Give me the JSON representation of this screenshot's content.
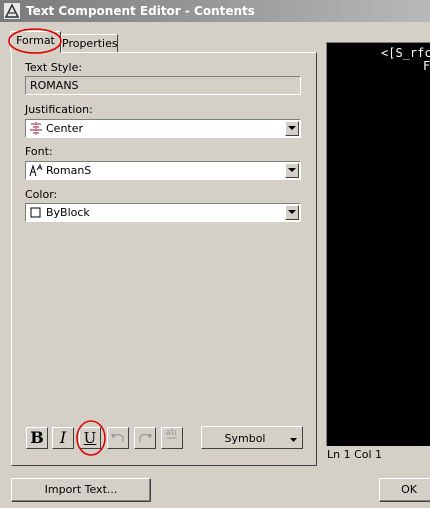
{
  "window": {
    "title": "Text Component Editor - Contents"
  },
  "tabs": [
    {
      "label": "Format",
      "active": true
    },
    {
      "label": "Properties",
      "active": false
    }
  ],
  "format": {
    "text_style": {
      "label": "Text Style:",
      "value": "ROMANS"
    },
    "justification": {
      "label": "Justification:",
      "value": "Center",
      "icon": "center-justify-icon"
    },
    "font": {
      "label": "Font:",
      "value": "RomanS",
      "icon": "shx-font-icon"
    },
    "color": {
      "label": "Color:",
      "value": "ByBlock",
      "icon": "color-swatch-icon"
    }
  },
  "toolbar": {
    "bold": "B",
    "italic": "I",
    "underline": "U",
    "stack": "ab",
    "symbol": "Symbol"
  },
  "editor": {
    "content": "<[S_rfc",
    "cursor_line": "F",
    "status": "Ln 1 Col 1"
  },
  "buttons": {
    "import": "Import Text...",
    "ok": "OK"
  },
  "colors": {
    "dialog_bg": "#d4d0c8",
    "title_bar": "#808080",
    "editor_bg": "#000000",
    "annotation": "#e00000"
  }
}
